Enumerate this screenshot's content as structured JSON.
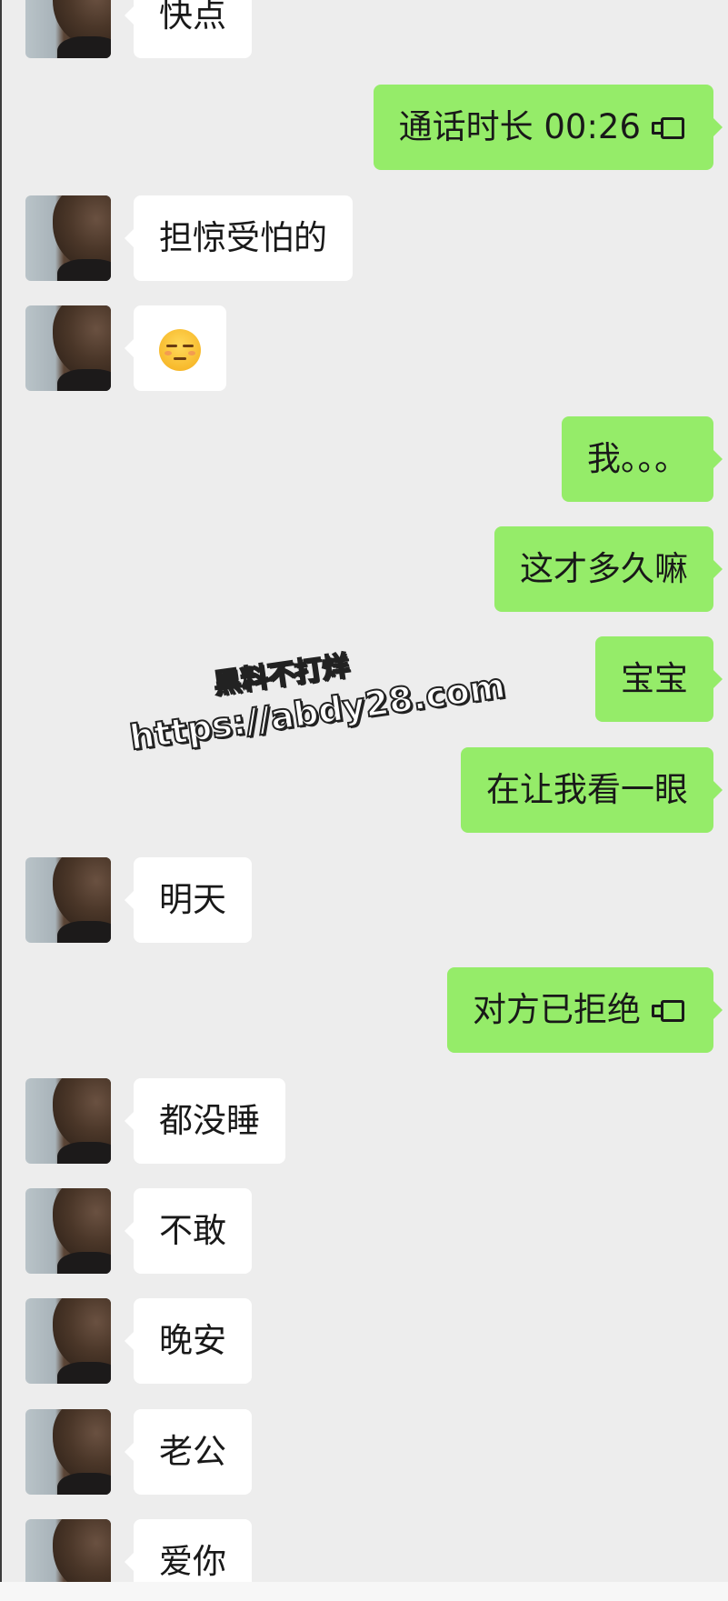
{
  "messages": [
    {
      "side": "in",
      "text": "快点",
      "kind": "text"
    },
    {
      "side": "out",
      "text": "通话时长 00:26",
      "kind": "call",
      "icon": "video-call-icon"
    },
    {
      "side": "in",
      "text": "担惊受怕的",
      "kind": "text"
    },
    {
      "side": "in",
      "text": "",
      "kind": "emoji",
      "icon": "unamused-face-emoji"
    },
    {
      "side": "out",
      "text": "我。。。",
      "kind": "text"
    },
    {
      "side": "out",
      "text": "这才多久嘛",
      "kind": "text"
    },
    {
      "side": "out",
      "text": "宝宝",
      "kind": "text"
    },
    {
      "side": "out",
      "text": "在让我看一眼",
      "kind": "text"
    },
    {
      "side": "in",
      "text": "明天",
      "kind": "text"
    },
    {
      "side": "out",
      "text": "对方已拒绝",
      "kind": "call",
      "icon": "video-call-icon"
    },
    {
      "side": "in",
      "text": "都没睡",
      "kind": "text"
    },
    {
      "side": "in",
      "text": "不敢",
      "kind": "text"
    },
    {
      "side": "in",
      "text": "晚安",
      "kind": "text"
    },
    {
      "side": "in",
      "text": "老公",
      "kind": "text"
    },
    {
      "side": "in",
      "text": "爱你",
      "kind": "text"
    }
  ],
  "watermark": {
    "line1": "黑料不打烊",
    "line2": "https://abdy28.com"
  },
  "colors": {
    "background": "#ededed",
    "incoming_bubble": "#ffffff",
    "outgoing_bubble": "#95ec69",
    "text": "#191919"
  }
}
